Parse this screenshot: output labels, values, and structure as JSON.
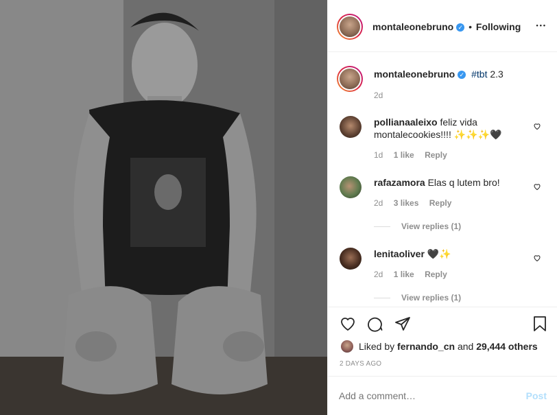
{
  "header": {
    "username": "montaleonebruno",
    "separator": "•",
    "follow_status": "Following",
    "more_label": "•••"
  },
  "caption": {
    "username": "montaleonebruno",
    "hashtag": "#tbt",
    "text": " 2.3",
    "time": "2d"
  },
  "comments": [
    {
      "username": "pollianaaleixo",
      "text": "feliz vida montalecookies!!!! ✨✨✨🖤",
      "time": "1d",
      "likes": "1 like",
      "reply": "Reply"
    },
    {
      "username": "rafazamora",
      "text": "Elas q lutem bro!",
      "time": "2d",
      "likes": "3 likes",
      "reply": "Reply",
      "view_replies": "View replies (1)"
    },
    {
      "username": "lenitaoliver",
      "text": "🖤✨",
      "time": "2d",
      "likes": "1 like",
      "reply": "Reply",
      "view_replies": "View replies (1)"
    }
  ],
  "likes": {
    "prefix": "Liked by",
    "user": "fernando_cn",
    "and": "and",
    "others": "29,444 others"
  },
  "timestamp": "2 DAYS AGO",
  "add_comment": {
    "placeholder": "Add a comment…",
    "post_label": "Post"
  },
  "colors": {
    "verified": "#3897f0",
    "post_button": "#b2dffc",
    "hashtag": "#003569"
  }
}
